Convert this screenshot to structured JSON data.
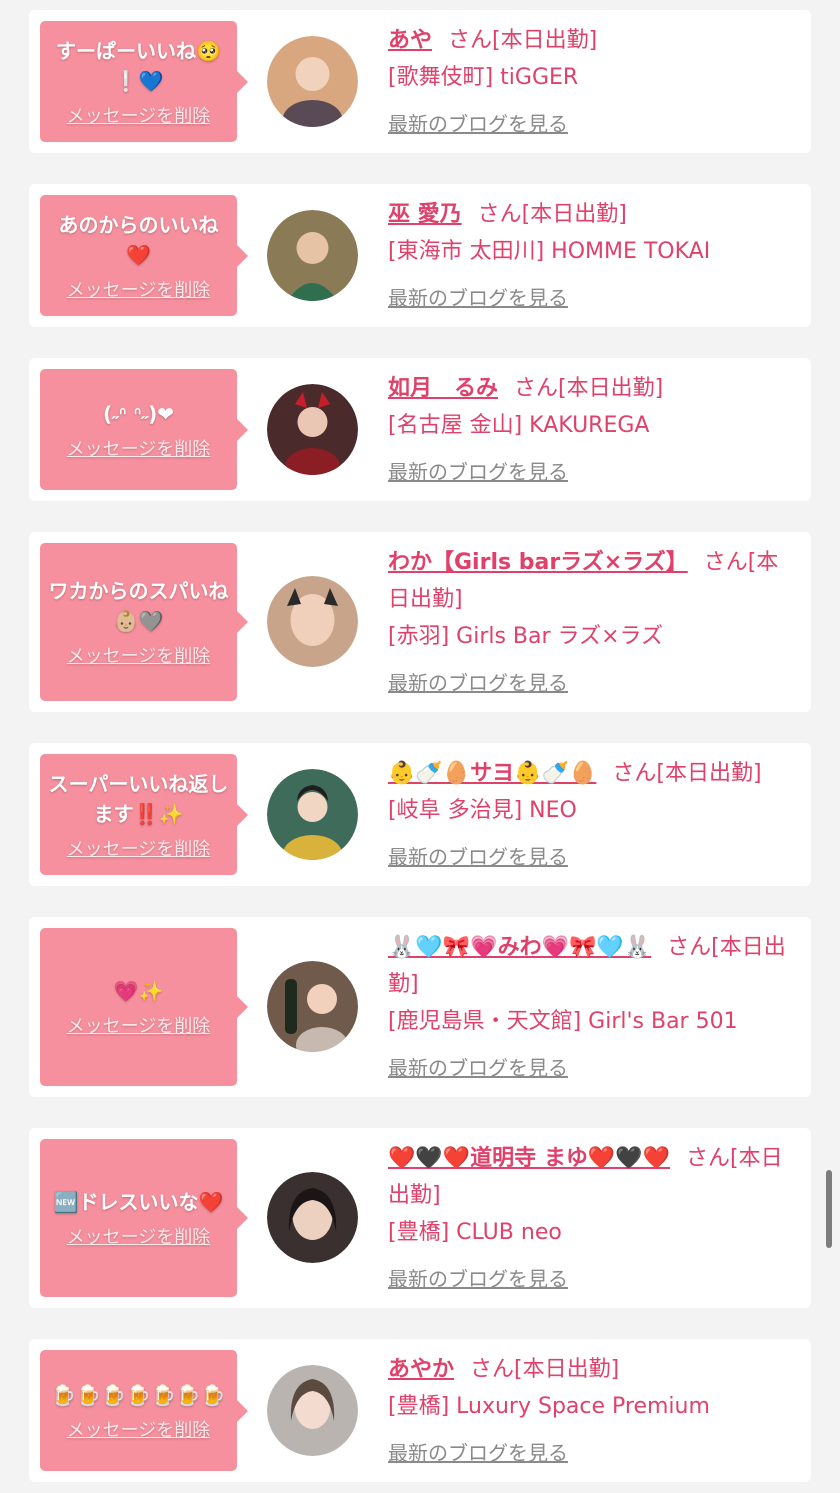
{
  "colors": {
    "page_bg": "#f3f3f3",
    "card_bg": "#ffffff",
    "bubble_bg": "#f6909e",
    "accent_pink": "#e0416a",
    "link_gray": "#8a8a8a"
  },
  "common": {
    "delete_label": "メッセージを削除",
    "blog_label": "最新のブログを見る",
    "san_suffix": "さん[本日出勤]"
  },
  "items": [
    {
      "message": "すーぱーいいね🥺❕💙",
      "name": "あや",
      "shop": "[歌舞伎町] tiGGER",
      "avatar_color": "#d9a77f"
    },
    {
      "message": "あのからのいいね❤️",
      "name": "巫 愛乃",
      "shop": "[東海市 太田川] HOMME TOKAI",
      "avatar_color": "#8a7a55"
    },
    {
      "message": "(˶ᐢ ᐢ˶)❤︎",
      "name": "如月　るみ",
      "shop": "[名古屋 金山] KAKUREGA",
      "avatar_color": "#4a2a2a"
    },
    {
      "message": "ワカからのスパいね👶🏼🩶",
      "name": "わか【Girls barラズ×ラズ】",
      "shop": "[赤羽] Girls Bar ラズ×ラズ",
      "avatar_color": "#c8a48a"
    },
    {
      "message": "スーパーいいね返します‼️✨",
      "name": "👶🍼🥚サヨ👶🍼🥚",
      "shop": "[岐阜 多治見] NEO",
      "avatar_color": "#3f6b5a"
    },
    {
      "message": "💗✨",
      "name": "🐰🩵🎀💗みわ💗🎀🩵🐰",
      "shop": "[鹿児島県・天文館] Girl's Bar 501",
      "avatar_color": "#6f5a4c"
    },
    {
      "message": "🆕ドレスいいな❤️",
      "name": "❤️🖤❤️道明寺 まゆ❤️🖤❤️",
      "shop": "[豊橋] CLUB neo",
      "avatar_color": "#3b3030"
    },
    {
      "message": "🍺🍺🍺🍺🍺🍺🍺",
      "name": "あやか",
      "shop": "[豊橋] Luxury Space Premium",
      "avatar_color": "#b9b4b0"
    }
  ]
}
